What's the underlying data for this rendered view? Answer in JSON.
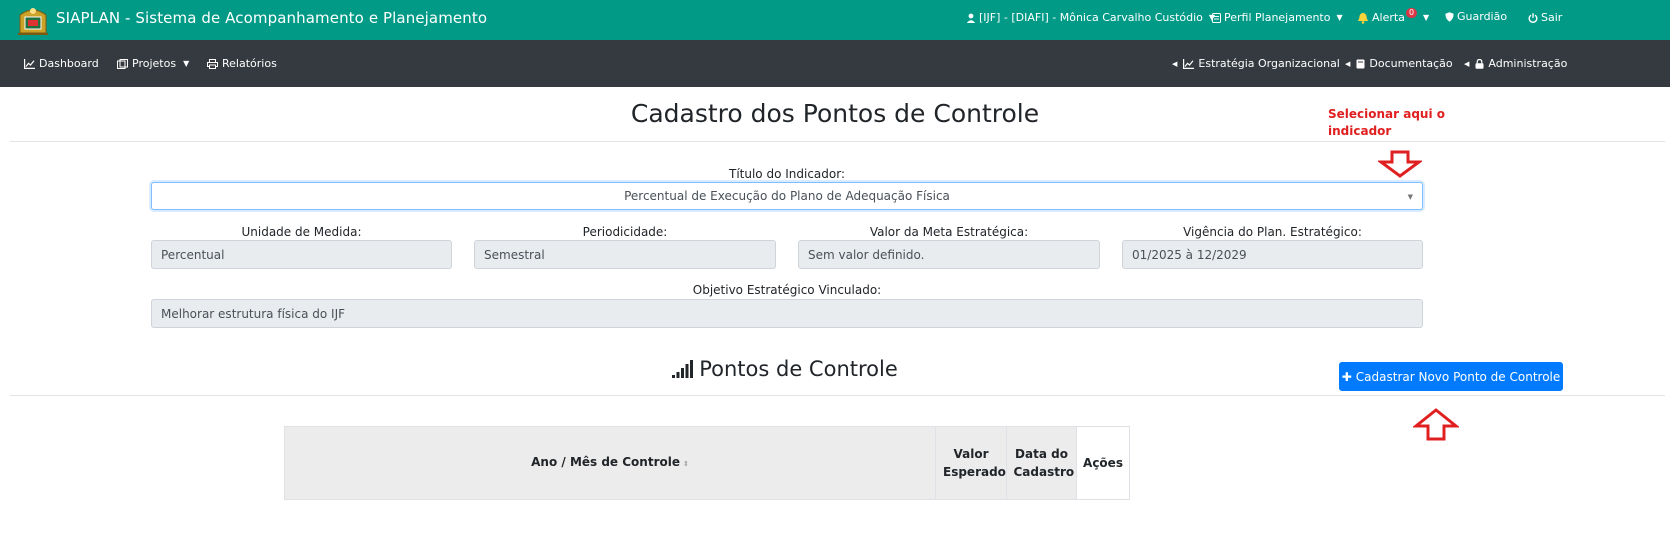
{
  "topbar": {
    "app_title": "SIAPLAN - Sistema de Acompanhamento e Planejamento",
    "user": "[IJF] - [DIAFI] - Mônica Carvalho Custódio",
    "profile": "Perfil Planejamento",
    "alert_label": "Alerta",
    "alert_count": "0",
    "guardian": "Guardião",
    "logout": "Sair",
    "color": "#009a87"
  },
  "navbar": {
    "color": "#343a40",
    "left_items": [
      {
        "label": "Dashboard",
        "icon": "line-chart-icon"
      },
      {
        "label": "Projetos",
        "icon": "projects-icon"
      },
      {
        "label": "Relatórios",
        "icon": "print-icon"
      }
    ],
    "right_items": [
      {
        "label": "Estratégia Organizacional",
        "icon": "line-chart-icon"
      },
      {
        "label": "Documentação",
        "icon": "book-icon"
      },
      {
        "label": "Administração",
        "icon": "lock-icon"
      }
    ]
  },
  "page": {
    "title": "Cadastro dos Pontos de Controle"
  },
  "annotations": {
    "select_hint": "Selecionar aqui o indicador",
    "color": "#e02020"
  },
  "form": {
    "indicator_label": "Título do Indicador:",
    "indicator_value": "Percentual de Execução do Plano de Adequação Física",
    "unit_label": "Unidade de Medida:",
    "unit_value": "Percentual",
    "periodicity_label": "Periodicidade:",
    "periodicity_value": "Semestral",
    "goal_label": "Valor da Meta Estratégica:",
    "goal_value": "Sem valor definido.",
    "validity_label": "Vigência do Plan. Estratégico:",
    "validity_value": "01/2025 à 12/2029",
    "objective_label": "Objetivo Estratégico Vinculado:",
    "objective_value": "Melhorar estrutura física do IJF"
  },
  "control_points": {
    "title": "Pontos de Controle",
    "add_button": "Cadastrar Novo Ponto de Controle",
    "button_color": "#007bff",
    "columns": [
      "Ano / Mês de Controle",
      "Valor Esperado",
      "Data do Cadastro",
      "Ações"
    ]
  }
}
